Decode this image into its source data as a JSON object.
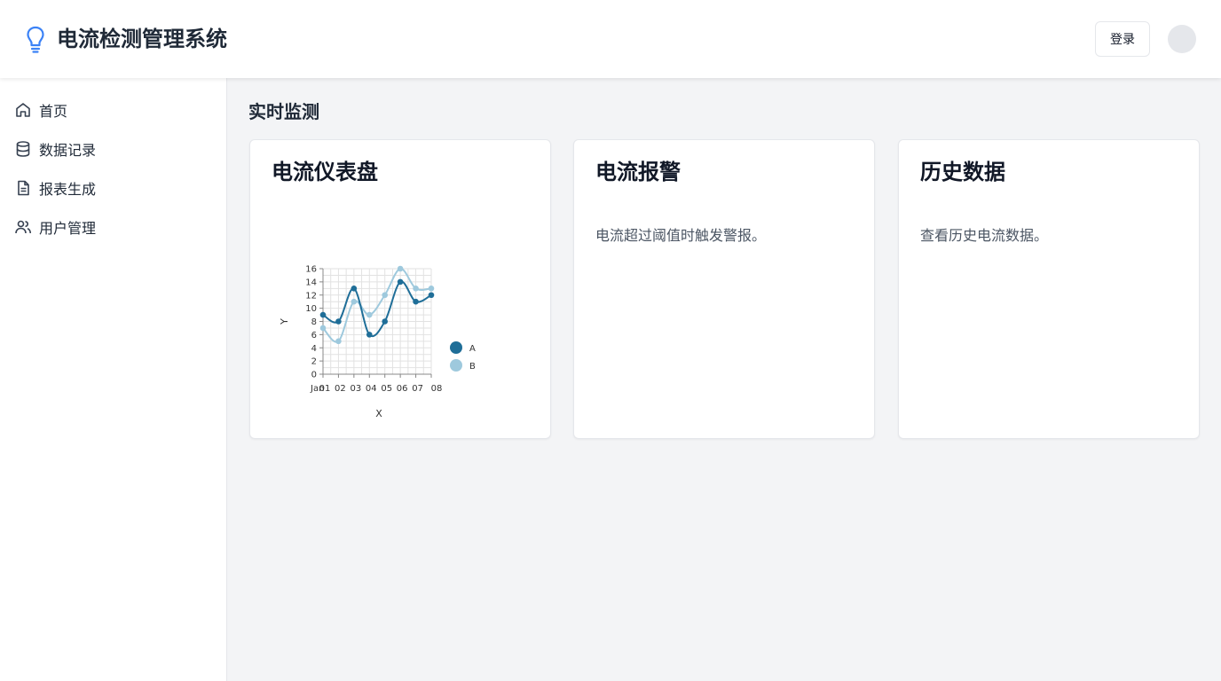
{
  "header": {
    "app_title": "电流检测管理系统",
    "login_label": "登录"
  },
  "sidebar": {
    "items": [
      {
        "label": "首页",
        "icon": "home-icon"
      },
      {
        "label": "数据记录",
        "icon": "database-icon"
      },
      {
        "label": "报表生成",
        "icon": "document-icon"
      },
      {
        "label": "用户管理",
        "icon": "users-icon"
      }
    ]
  },
  "main": {
    "section_title": "实时监测",
    "cards": [
      {
        "title": "电流仪表盘",
        "desc": ""
      },
      {
        "title": "电流报警",
        "desc": "电流超过阈值时触发警报。"
      },
      {
        "title": "历史数据",
        "desc": "查看历史电流数据。"
      }
    ]
  },
  "colors": {
    "accent": "#3b82f6",
    "series_a": "#1f6e98",
    "series_b": "#9ec9dd"
  },
  "chart_data": {
    "type": "line",
    "x": [
      "Jan 01",
      "02",
      "03",
      "04",
      "05",
      "06",
      "07",
      "08"
    ],
    "tick_labels": [
      "Jan",
      "01",
      "02",
      "03",
      "04",
      "05",
      "06",
      "07",
      "08"
    ],
    "series": [
      {
        "name": "A",
        "values": [
          9,
          8,
          13,
          6,
          8,
          14,
          11,
          12
        ]
      },
      {
        "name": "B",
        "values": [
          7,
          5,
          11,
          9,
          12,
          16,
          13,
          13
        ]
      }
    ],
    "xlabel": "X",
    "ylabel": "Y",
    "ylim": [
      0,
      16
    ],
    "yticks": [
      0,
      2,
      4,
      6,
      8,
      10,
      12,
      14,
      16
    ],
    "grid": true,
    "legend": "right"
  }
}
